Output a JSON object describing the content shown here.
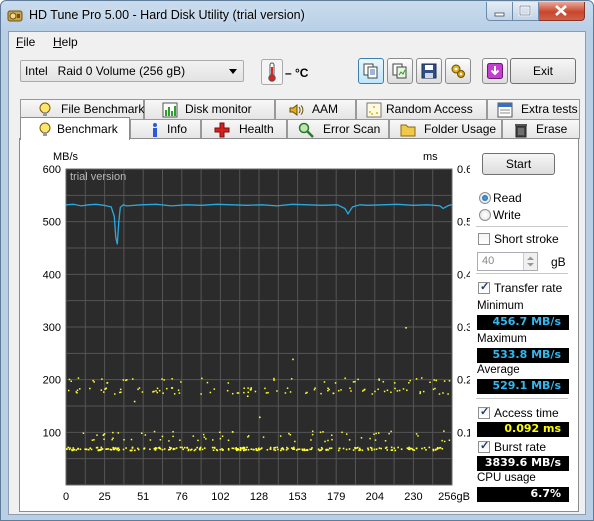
{
  "window": {
    "title": "HD Tune Pro 5.00 - Hard Disk Utility (trial version)"
  },
  "menu": [
    {
      "label": "File",
      "underline": "F",
      "rest": "ile"
    },
    {
      "label": "Help",
      "underline": "H",
      "rest": "elp"
    }
  ],
  "toolbar": {
    "drive": "Intel   Raid 0 Volume (256 gB)",
    "temperature": "– °C",
    "exit_label": "Exit",
    "buttons": [
      "copy-info-icon",
      "copy-screen-icon",
      "save-icon",
      "options-icon",
      "download-icon"
    ]
  },
  "tabs_top": [
    {
      "label": "File Benchmark",
      "icon": "file-benchmark-icon"
    },
    {
      "label": "Disk monitor",
      "icon": "disk-monitor-icon"
    },
    {
      "label": "AAM",
      "icon": "speaker-icon"
    },
    {
      "label": "Random Access",
      "icon": "random-access-icon"
    },
    {
      "label": "Extra tests",
      "icon": "extra-tests-icon"
    }
  ],
  "tabs_bottom": [
    {
      "label": "Benchmark",
      "icon": "lightbulb-icon",
      "selected": true
    },
    {
      "label": "Info",
      "icon": "info-icon"
    },
    {
      "label": "Health",
      "icon": "health-cross-icon"
    },
    {
      "label": "Error Scan",
      "icon": "magnifier-icon"
    },
    {
      "label": "Folder Usage",
      "icon": "folder-icon"
    },
    {
      "label": "Erase",
      "icon": "trash-icon"
    }
  ],
  "benchmark": {
    "start_label": "Start",
    "read_label": "Read",
    "write_label": "Write",
    "mode": "read",
    "short_stroke_label": "Short stroke",
    "short_stroke_checked": false,
    "short_stroke_value": "40",
    "short_stroke_unit": "gB",
    "transfer_rate_label": "Transfer rate",
    "transfer_rate_checked": true,
    "minimum_label": "Minimum",
    "minimum": "456.7 MB/s",
    "maximum_label": "Maximum",
    "maximum": "533.8 MB/s",
    "average_label": "Average",
    "average": "529.1 MB/s",
    "access_time_label": "Access time",
    "access_time_checked": true,
    "access_time": "0.092 ms",
    "burst_rate_label": "Burst rate",
    "burst_rate_checked": true,
    "burst_rate": "3839.6 MB/s",
    "cpu_usage_label": "CPU usage",
    "cpu_usage": "6.7%"
  },
  "chart_data": {
    "type": "line",
    "watermark": "trial version",
    "left_unit": "MB/s",
    "right_unit": "ms",
    "ylim": [
      0,
      600
    ],
    "y2lim": [
      0,
      0.6
    ],
    "yticks": [
      "600",
      "500",
      "400",
      "300",
      "200",
      "100"
    ],
    "y2ticks": [
      "0.60",
      "0.50",
      "0.40",
      "0.30",
      "0.20",
      "0.10"
    ],
    "xlim": [
      0,
      256
    ],
    "xticks": [
      "0",
      "25",
      "51",
      "76",
      "102",
      "128",
      "153",
      "179",
      "204",
      "230",
      "256gB"
    ],
    "grid": true,
    "series": [
      {
        "color": "#2aa9e0",
        "x": [
          0,
          5,
          10,
          15,
          20,
          25,
          30,
          32,
          33,
          34,
          35,
          36,
          38,
          40,
          50,
          60,
          70,
          80,
          90,
          100,
          110,
          120,
          130,
          140,
          150,
          160,
          170,
          180,
          185,
          187,
          190,
          195,
          200,
          210,
          220,
          230,
          240,
          248,
          250,
          254,
          256
        ],
        "y": [
          532,
          533,
          530,
          532,
          533,
          531,
          528,
          510,
          470,
          457,
          500,
          527,
          532,
          530,
          532,
          533,
          530,
          532,
          531,
          533,
          532,
          531,
          532,
          530,
          533,
          532,
          531,
          532,
          525,
          515,
          528,
          532,
          531,
          532,
          533,
          531,
          532,
          530,
          525,
          531,
          532
        ]
      }
    ],
    "access_time_scatter": {
      "color": "#ffff33",
      "x_bands_ms": [
        0.07,
        0.09,
        0.18,
        0.2
      ],
      "outliers": [
        [
          45,
          0.16
        ],
        [
          120,
          0.17
        ],
        [
          128,
          0.13
        ],
        [
          150,
          0.24
        ],
        [
          225,
          0.3
        ],
        [
          245,
          0.2
        ]
      ]
    }
  }
}
